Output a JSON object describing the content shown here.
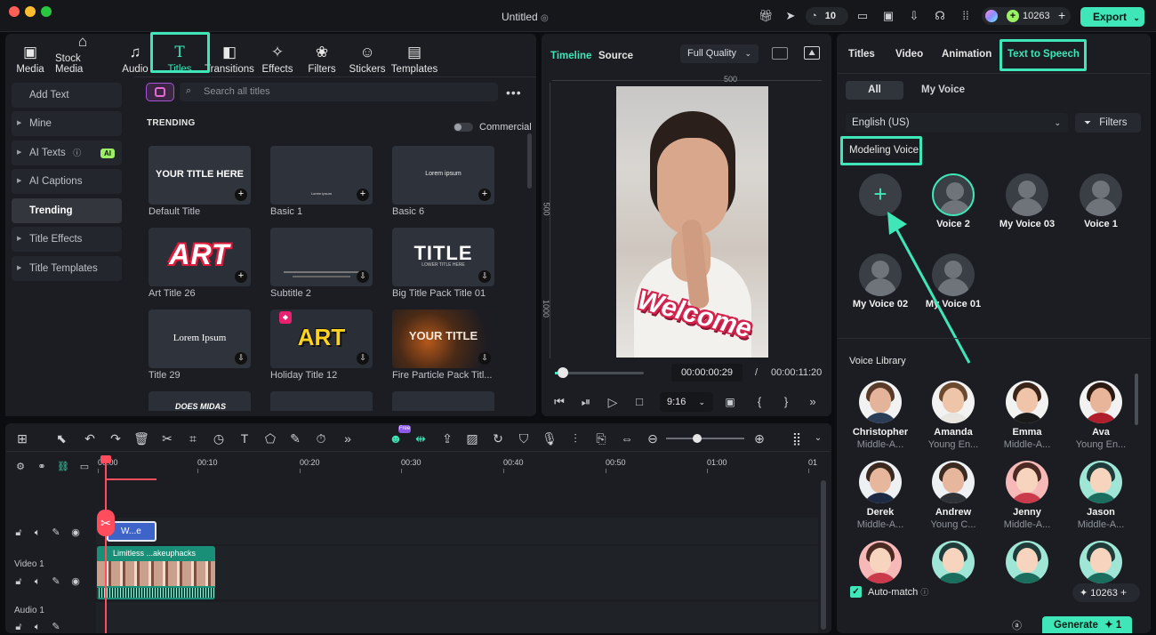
{
  "app": {
    "title": "Untitled",
    "credits": "10263",
    "notif_count": "10",
    "export_label": "Export"
  },
  "toolbar": {
    "tabs": [
      {
        "label": "Media",
        "icon": "media-icon"
      },
      {
        "label": "Stock Media",
        "icon": "stock-media-icon"
      },
      {
        "label": "Audio",
        "icon": "audio-icon"
      },
      {
        "label": "Titles",
        "icon": "titles-icon"
      },
      {
        "label": "Transitions",
        "icon": "transitions-icon"
      },
      {
        "label": "Effects",
        "icon": "effects-icon"
      },
      {
        "label": "Filters",
        "icon": "filters-icon"
      },
      {
        "label": "Stickers",
        "icon": "stickers-icon"
      },
      {
        "label": "Templates",
        "icon": "templates-icon"
      }
    ]
  },
  "sidebar": {
    "items": [
      {
        "label": "Add Text"
      },
      {
        "label": "Mine"
      },
      {
        "label": "AI Texts",
        "badge": "AI"
      },
      {
        "label": "AI Captions"
      },
      {
        "label": "Trending"
      },
      {
        "label": "Title Effects"
      },
      {
        "label": "Title Templates"
      }
    ]
  },
  "library": {
    "search_placeholder": "Search all titles",
    "section": "TRENDING",
    "commercial_label": "Commercial",
    "cards": [
      {
        "label": "Default Title",
        "thumb_text": "YOUR TITLE HERE"
      },
      {
        "label": "Basic 1",
        "thumb_text": "Lorem ipsum"
      },
      {
        "label": "Basic 6",
        "thumb_text": "Lorem ipsum"
      },
      {
        "label": "Art Title 26",
        "thumb_text": "ART"
      },
      {
        "label": "Subtitle 2",
        "thumb_text": ""
      },
      {
        "label": "Big Title Pack Title 01",
        "thumb_text": "TITLE",
        "thumb_sub": "LOWER TITLE HERE"
      },
      {
        "label": "Title 29",
        "thumb_text": "Lorem Ipsum"
      },
      {
        "label": "Holiday Title 12",
        "thumb_text": "ART"
      },
      {
        "label": "Fire Particle Pack Titl...",
        "thumb_text": "YOUR TITLE"
      }
    ],
    "partial_thumb_text": "DOES MIDAS"
  },
  "preview": {
    "tab_timeline": "Timeline",
    "tab_source": "Source",
    "quality": "Full Quality",
    "ruler_500": "500",
    "ruler_side_500": "500",
    "ruler_side_1000": "1000",
    "video_text": "Welcome",
    "current_time": "00:00:00:29",
    "separator": "/",
    "total_time": "00:00:11:20",
    "ratio": "9:16",
    "progress": 0.04
  },
  "right": {
    "tabs": [
      "Titles",
      "Video",
      "Animation",
      "Text to Speech"
    ],
    "filter_all": "All",
    "filter_my_voice": "My Voice",
    "language": "English (US)",
    "filters_label": "Filters",
    "modeling_voice": "Modeling Voice",
    "my_voices": [
      "Voice 2",
      "My Voice 03",
      "Voice 1",
      "My Voice 02",
      "My Voice 01"
    ],
    "voice_library": "Voice Library",
    "library": [
      {
        "name": "Christopher",
        "desc": "Middle-A..."
      },
      {
        "name": "Amanda",
        "desc": "Young En..."
      },
      {
        "name": "Emma",
        "desc": "Middle-A..."
      },
      {
        "name": "Ava",
        "desc": "Young En..."
      },
      {
        "name": "Derek",
        "desc": "Middle-A..."
      },
      {
        "name": "Andrew",
        "desc": "Young C..."
      },
      {
        "name": "Jenny",
        "desc": "Middle-A..."
      },
      {
        "name": "Jason",
        "desc": "Middle-A..."
      }
    ],
    "auto_match": "Auto-match",
    "credits": "10263",
    "generate": "Generate",
    "generate_cost": "1"
  },
  "timeline": {
    "ruler": [
      "00:00",
      "00:10",
      "00:20",
      "00:30",
      "00:40",
      "00:50",
      "01:00",
      "01"
    ],
    "title_clip": "W...e",
    "video_clip": "Limitless ...akeuphacks",
    "track_video": "Video 1",
    "track_audio": "Audio 1",
    "new_badge": "Free"
  },
  "colors": {
    "accent": "#3ee6b8",
    "playhead": "#ff4d5e"
  }
}
